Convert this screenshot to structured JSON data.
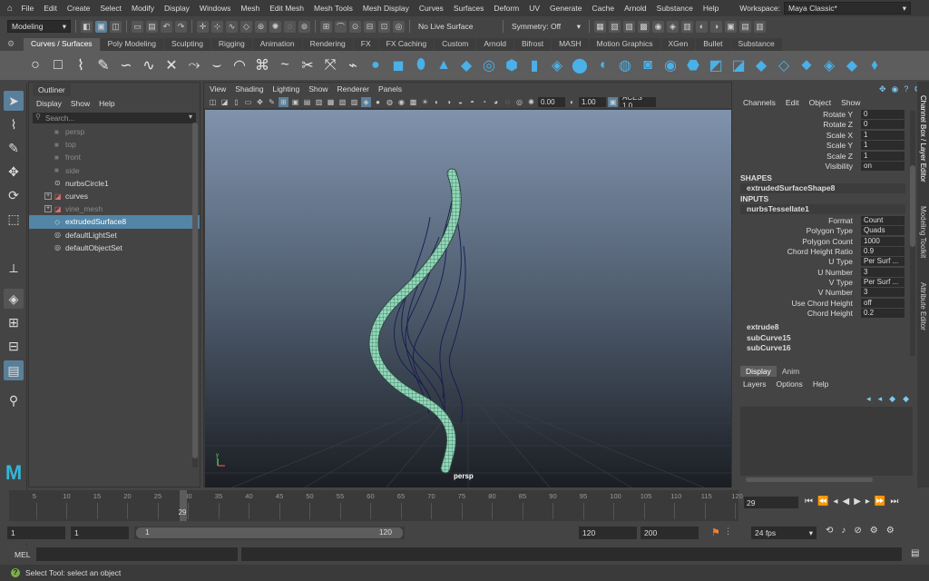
{
  "menubar": {
    "items": [
      "File",
      "Edit",
      "Create",
      "Select",
      "Modify",
      "Display",
      "Windows",
      "Mesh",
      "Edit Mesh",
      "Mesh Tools",
      "Mesh Display",
      "Curves",
      "Surfaces",
      "Deform",
      "UV",
      "Generate",
      "Cache",
      "Arnold",
      "Substance",
      "Help"
    ],
    "workspace_label": "Workspace:",
    "workspace_value": "Maya Classic*"
  },
  "statusline": {
    "mode": "Modeling",
    "live_surface": "No Live Surface",
    "symmetry": "Symmetry: Off"
  },
  "shelf_tabs": [
    "Curves / Surfaces",
    "Poly Modeling",
    "Sculpting",
    "Rigging",
    "Animation",
    "Rendering",
    "FX",
    "FX Caching",
    "Custom",
    "Arnold",
    "Bifrost",
    "MASH",
    "Motion Graphics",
    "XGen",
    "Bullet",
    "Substance"
  ],
  "outliner": {
    "tab": "Outliner",
    "menu": [
      "Display",
      "Show",
      "Help"
    ],
    "search_placeholder": "Search...",
    "items": [
      {
        "label": "persp",
        "icon": "camera-icon",
        "dim": true,
        "selected": false,
        "expand": false
      },
      {
        "label": "top",
        "icon": "camera-icon",
        "dim": true,
        "selected": false,
        "expand": false
      },
      {
        "label": "front",
        "icon": "camera-icon",
        "dim": true,
        "selected": false,
        "expand": false
      },
      {
        "label": "side",
        "icon": "camera-icon",
        "dim": true,
        "selected": false,
        "expand": false
      },
      {
        "label": "nurbsCircle1",
        "icon": "curve-icon",
        "dim": false,
        "selected": false,
        "expand": false
      },
      {
        "label": "curves",
        "icon": "group-icon",
        "dim": false,
        "selected": false,
        "expand": true
      },
      {
        "label": "vine_mesh",
        "icon": "group-icon",
        "dim": true,
        "selected": false,
        "expand": true
      },
      {
        "label": "extrudedSurface8",
        "icon": "surface-icon",
        "dim": false,
        "selected": true,
        "expand": false
      },
      {
        "label": "defaultLightSet",
        "icon": "set-icon",
        "dim": false,
        "selected": false,
        "expand": false
      },
      {
        "label": "defaultObjectSet",
        "icon": "set-icon",
        "dim": false,
        "selected": false,
        "expand": false
      }
    ]
  },
  "viewport": {
    "menu": [
      "View",
      "Shading",
      "Lighting",
      "Show",
      "Renderer",
      "Panels"
    ],
    "exposure": "0.00",
    "gamma": "1.00",
    "colorspace": "ACES 1.0",
    "camera": "persp"
  },
  "channelbox": {
    "menu": [
      "Channels",
      "Edit",
      "Object",
      "Show"
    ],
    "top_attrs": [
      {
        "label": "Rotate Y",
        "value": "0"
      },
      {
        "label": "Rotate Z",
        "value": "0"
      },
      {
        "label": "Scale X",
        "value": "1"
      },
      {
        "label": "Scale Y",
        "value": "1"
      },
      {
        "label": "Scale Z",
        "value": "1"
      },
      {
        "label": "Visibility",
        "value": "on"
      }
    ],
    "shapes_header": "SHAPES",
    "shape_node": "extrudedSurfaceShape8",
    "inputs_header": "INPUTS",
    "input_node": "nurbsTessellate1",
    "input_attrs": [
      {
        "label": "Format",
        "value": "Count"
      },
      {
        "label": "Polygon Type",
        "value": "Quads"
      },
      {
        "label": "Polygon Count",
        "value": "1000"
      },
      {
        "label": "Chord Height Ratio",
        "value": "0.9"
      },
      {
        "label": "U Type",
        "value": "Per Surf ..."
      },
      {
        "label": "U Number",
        "value": "3"
      },
      {
        "label": "V Type",
        "value": "Per Surf ..."
      },
      {
        "label": "V Number",
        "value": "3"
      },
      {
        "label": "Use Chord Height",
        "value": "off"
      },
      {
        "label": "Chord Height",
        "value": "0.2"
      }
    ],
    "other_nodes": [
      "extrude8",
      "subCurve15",
      "subCurve16"
    ]
  },
  "side_tabs": [
    "Channel Box / Layer Editor",
    "Modeling Toolkit",
    "Attribute Editor"
  ],
  "layers": {
    "tabs": [
      "Display",
      "Anim"
    ],
    "menu": [
      "Layers",
      "Options",
      "Help"
    ]
  },
  "timeline": {
    "ticks": [
      "5",
      "10",
      "15",
      "20",
      "25",
      "30",
      "35",
      "40",
      "45",
      "50",
      "55",
      "60",
      "65",
      "70",
      "75",
      "80",
      "85",
      "90",
      "95",
      "100",
      "105",
      "110",
      "115",
      "120"
    ],
    "current_frame": "29",
    "current_field": "29"
  },
  "range": {
    "start": "1",
    "playback_start": "1",
    "bar_start": "1",
    "bar_end": "120",
    "playback_end": "120",
    "end": "200",
    "fps": "24 fps"
  },
  "cmdline": {
    "label": "MEL"
  },
  "helpline": {
    "text": "Select Tool: select an object"
  }
}
